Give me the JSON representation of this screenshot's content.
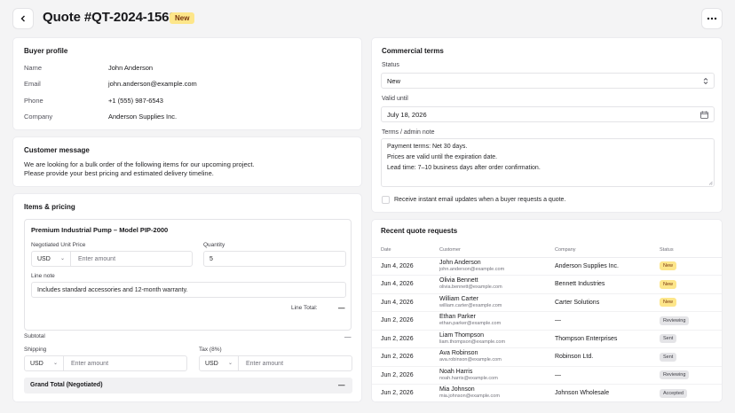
{
  "header": {
    "title": "Quote #QT-2024-1568",
    "status": "New"
  },
  "buyer": {
    "title": "Buyer profile",
    "rows": [
      {
        "label": "Name",
        "value": "John Anderson"
      },
      {
        "label": "Email",
        "value": "john.anderson@example.com"
      },
      {
        "label": "Phone",
        "value": "+1 (555) 987-6543"
      },
      {
        "label": "Company",
        "value": "Anderson Supplies Inc."
      }
    ]
  },
  "message": {
    "title": "Customer message",
    "line1": "We are looking for a bulk order of the following items for our upcoming project.",
    "line2": "Please provide your best pricing and estimated delivery timeline."
  },
  "items": {
    "title": "Items & pricing",
    "product_name": "Premium Industrial Pump – Model PIP-2000",
    "unit_price_label": "Negotiated Unit Price",
    "currency": "USD",
    "amount_placeholder": "Enter amount",
    "quantity_label": "Quantity",
    "quantity": "5",
    "line_note_label": "Line note",
    "line_note": "Includes standard accessories and 12-month warranty.",
    "line_total_label": "Line Total:",
    "line_total_value": "—",
    "subtotal_label": "Subtotal",
    "subtotal_value": "—",
    "shipping_label": "Shipping",
    "shipping_currency": "USD",
    "shipping_placeholder": "Enter amount",
    "tax_label": "Tax (8%)",
    "tax_currency": "USD",
    "tax_placeholder": "Enter amount",
    "grand_total_label": "Grand Total (Negotiated)",
    "grand_total_value": "—"
  },
  "terms": {
    "title": "Commercial terms",
    "status_label": "Status",
    "status_value": "New",
    "valid_label": "Valid until",
    "valid_value": "July 18, 2026",
    "note_label": "Terms / admin note",
    "note_lines": [
      "Payment terms: Net 30 days.",
      "Prices are valid until the expiration date.",
      "Lead time: 7–10 business days after order confirmation."
    ],
    "email_checkbox_label": "Receive instant email updates when a buyer requests a quote."
  },
  "requests": {
    "title": "Recent quote requests",
    "columns": [
      "Date",
      "Customer",
      "Company",
      "Status"
    ],
    "rows": [
      {
        "date": "Jun 4, 2026",
        "name": "John Anderson",
        "email": "john.anderson@example.com",
        "company": "Anderson Supplies Inc.",
        "status": "New"
      },
      {
        "date": "Jun 4, 2026",
        "name": "Olivia Bennett",
        "email": "olivia.bennett@example.com",
        "company": "Bennett Industries",
        "status": "New"
      },
      {
        "date": "Jun 4, 2026",
        "name": "William Carter",
        "email": "william.carter@example.com",
        "company": "Carter Solutions",
        "status": "New"
      },
      {
        "date": "Jun 2, 2026",
        "name": "Ethan Parker",
        "email": "ethan.parker@example.com",
        "company": "—",
        "status": "Reviewing"
      },
      {
        "date": "Jun 2, 2026",
        "name": "Liam Thompson",
        "email": "liam.thompson@example.com",
        "company": "Thompson Enterprises",
        "status": "Sent"
      },
      {
        "date": "Jun 2, 2026",
        "name": "Ava Robinson",
        "email": "ava.robinson@example.com",
        "company": "Robinson Ltd.",
        "status": "Sent"
      },
      {
        "date": "Jun 2, 2026",
        "name": "Noah Harris",
        "email": "noah.harris@example.com",
        "company": "—",
        "status": "Reviewing"
      },
      {
        "date": "Jun 2, 2026",
        "name": "Mia Johnson",
        "email": "mia.johnson@example.com",
        "company": "Johnson Wholesale",
        "status": "Accepted"
      }
    ]
  },
  "colors": {
    "badge_new": "#fde68a",
    "badge_gray": "#e4e4e7"
  }
}
